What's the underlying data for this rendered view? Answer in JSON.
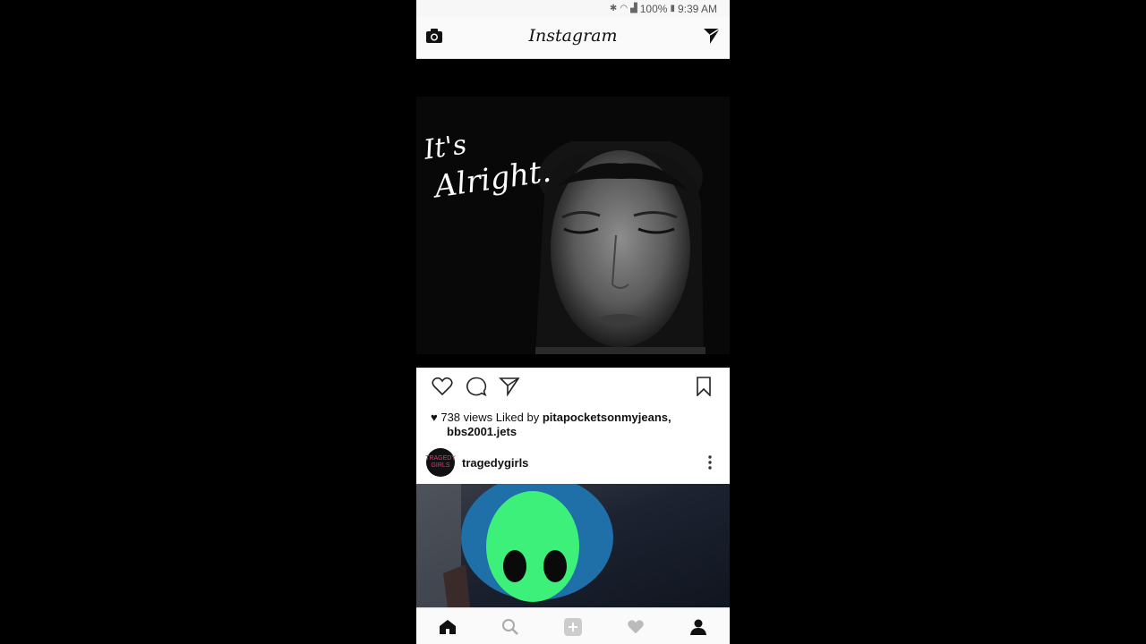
{
  "status_bar": {
    "battery": "100%",
    "time": "9:39 AM"
  },
  "header": {
    "title": "Instagram"
  },
  "post1": {
    "overlay_line1": "It's",
    "overlay_line2": "Alright."
  },
  "post_stats": {
    "views": "738 views",
    "liked_by_prefix": "Liked by",
    "liker1": "pitapocketsonmyjeans,",
    "liker2": "bbs2001.jets"
  },
  "next_post": {
    "account_name": "tragedygirls",
    "avatar_text": "TRAGEDY GIRLS"
  },
  "colors": {
    "background": "#000000",
    "bar": "#fafafa",
    "text": "#111111",
    "avatar_pink": "#e0377f",
    "mask_green": "#3df07a"
  }
}
